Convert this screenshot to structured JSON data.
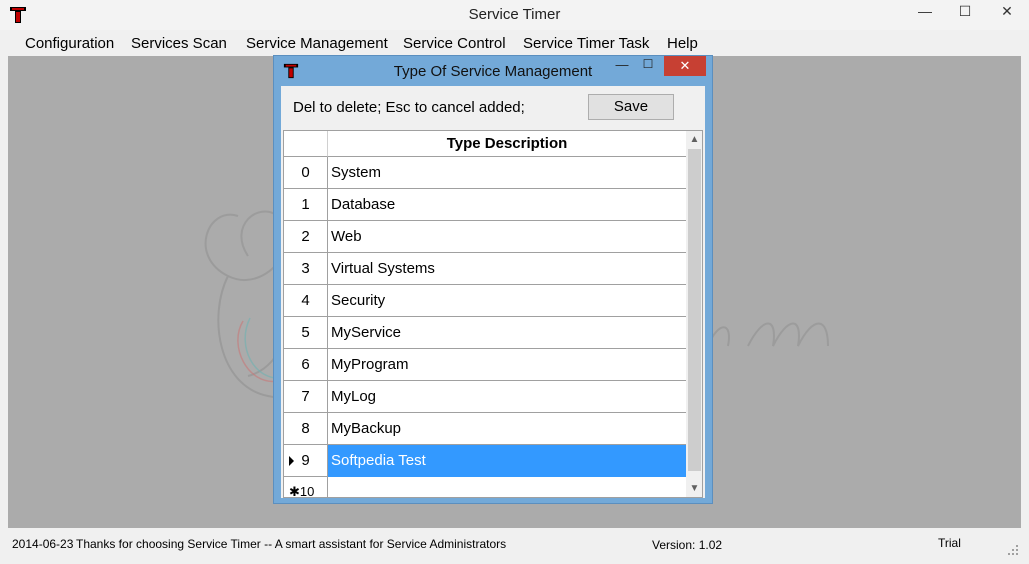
{
  "window": {
    "title": "Service Timer",
    "minimize": "—",
    "maximize": "☐",
    "close": "✕"
  },
  "menu": {
    "items": [
      "Configuration",
      "Services Scan",
      "Service Management",
      "Service Control",
      "Service Timer Task",
      "Help"
    ]
  },
  "dialog": {
    "title": "Type Of Service Management",
    "minimize": "—",
    "maximize": "☐",
    "close": "✕",
    "hint": "Del to delete; Esc to cancel added;",
    "save_label": "Save",
    "grid": {
      "column_header": "Type Description",
      "rows": [
        {
          "index": "0",
          "description": "System"
        },
        {
          "index": "1",
          "description": "Database"
        },
        {
          "index": "2",
          "description": "Web"
        },
        {
          "index": "3",
          "description": "Virtual Systems"
        },
        {
          "index": "4",
          "description": "Security"
        },
        {
          "index": "5",
          "description": "MyService"
        },
        {
          "index": "6",
          "description": "MyProgram"
        },
        {
          "index": "7",
          "description": "MyLog"
        },
        {
          "index": "8",
          "description": "MyBackup"
        },
        {
          "index": "9",
          "description": "Softpedia Test",
          "selected": true
        }
      ],
      "new_row": {
        "index": "10",
        "marker": "✱",
        "description": ""
      }
    }
  },
  "status": {
    "date": "2014-06-23",
    "message": "Thanks for choosing Service Timer -- A smart assistant for Service Administrators",
    "version": "Version: 1.02",
    "license": "Trial"
  },
  "colors": {
    "accent": "#3399ff",
    "dialog_frame": "#73a9d8",
    "close_button": "#c74033",
    "workspace": "#ababab"
  },
  "icons": [
    "app-icon",
    "dialog-icon",
    "scroll-up-icon",
    "scroll-down-icon",
    "row-pointer-icon",
    "new-row-icon",
    "size-grip-icon"
  ]
}
